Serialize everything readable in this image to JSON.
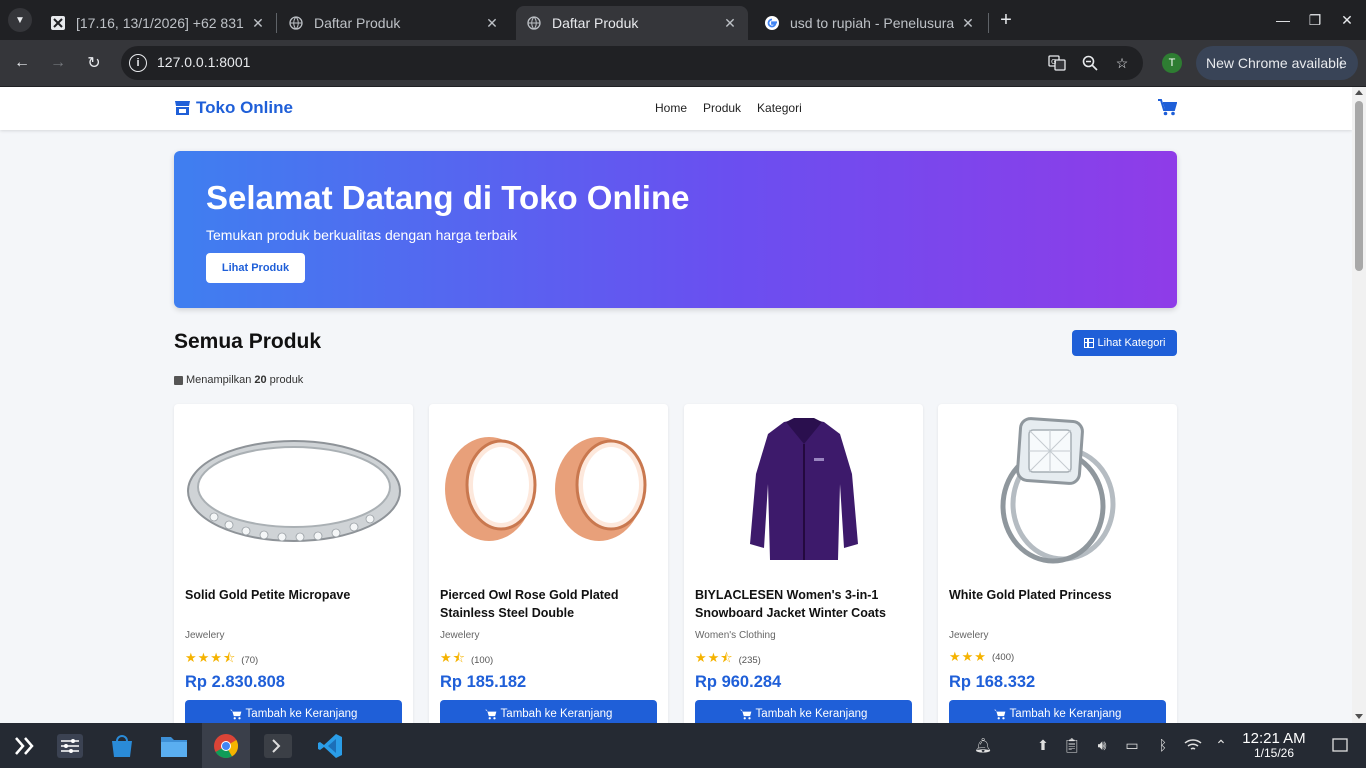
{
  "browser": {
    "tabs": [
      {
        "title": "[17.16, 13/1/2026] +62 831-"
      },
      {
        "title": "Daftar Produk"
      },
      {
        "title": "Daftar Produk"
      },
      {
        "title": "usd to rupiah - Penelusuran"
      }
    ],
    "url": "127.0.0.1:8001",
    "profile_initial": "T",
    "update_label": "New Chrome available"
  },
  "site": {
    "brand": "Toko Online",
    "nav": [
      "Home",
      "Produk",
      "Kategori"
    ],
    "hero": {
      "title": "Selamat Datang di Toko Online",
      "subtitle": "Temukan produk berkualitas dengan harga terbaik",
      "button": "Lihat Produk"
    },
    "section_title": "Semua Produk",
    "category_button": "Lihat Kategori",
    "count_prefix": "Menampilkan",
    "count": "20",
    "count_suffix": "produk",
    "add_to_cart": "Tambah ke Keranjang",
    "products": [
      {
        "name": "Solid Gold Petite Micropave",
        "category": "Jewelery",
        "stars": "★★★⯪",
        "reviews": "(70)",
        "price": "Rp 2.830.808"
      },
      {
        "name": "Pierced Owl Rose Gold Plated Stainless Steel Double",
        "category": "Jewelery",
        "stars": "★⯪",
        "reviews": "(100)",
        "price": "Rp 185.182"
      },
      {
        "name": "BIYLACLESEN Women's 3-in-1 Snowboard Jacket Winter Coats",
        "category": "Women's Clothing",
        "stars": "★★⯪",
        "reviews": "(235)",
        "price": "Rp 960.284"
      },
      {
        "name": "White Gold Plated Princess",
        "category": "Jewelery",
        "stars": "★★★",
        "reviews": "(400)",
        "price": "Rp 168.332"
      }
    ]
  },
  "taskbar": {
    "time": "12:21 AM",
    "date": "1/15/26"
  },
  "colors": {
    "accent": "#1f5fd8",
    "hero_start": "#3f7ff0",
    "hero_end": "#8f3ce8",
    "star": "#f5b301"
  }
}
